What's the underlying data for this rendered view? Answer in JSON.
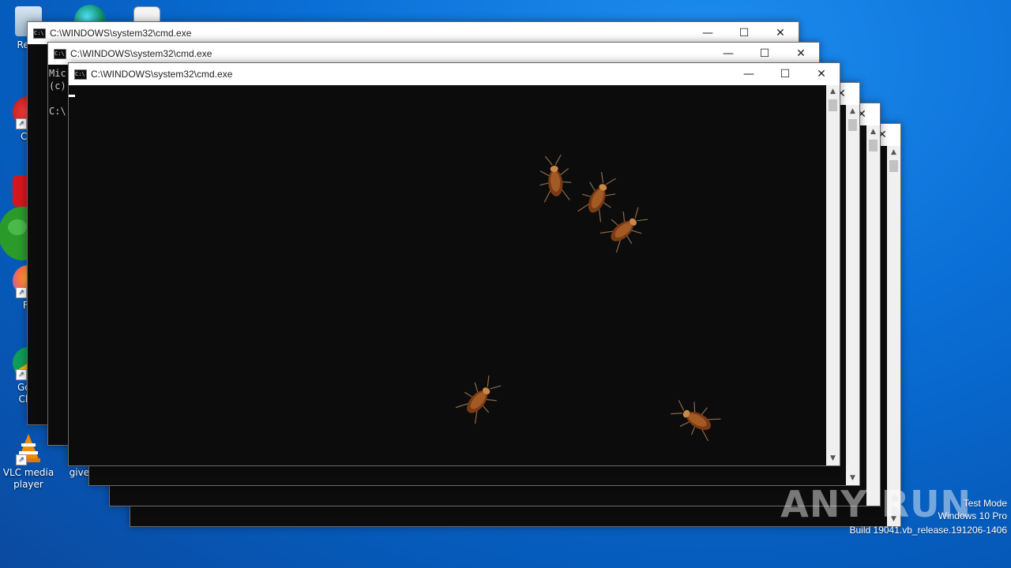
{
  "desktop": {
    "icons": [
      {
        "name": "recycle-bin",
        "label": "Recy"
      },
      {
        "name": "ccleaner",
        "label": "CCl"
      },
      {
        "name": "acrobat",
        "label": ""
      },
      {
        "name": "firefox",
        "label": "Fir"
      },
      {
        "name": "chrome",
        "label": "Goo Chr"
      },
      {
        "name": "vlc",
        "label": "VLC media player"
      },
      {
        "name": "givenh",
        "label": "givenh"
      }
    ]
  },
  "windows": [
    {
      "title": "C:\\WINDOWS\\system32\\cmd.exe"
    },
    {
      "title": "C:\\WINDOWS\\system32\\cmd.exe",
      "console_lines": [
        "Mic",
        "(c)",
        "",
        "C:\\"
      ]
    },
    {
      "title": "C:\\WINDOWS\\system32\\cmd.exe"
    }
  ],
  "titlebar_buttons": {
    "minimize": "—",
    "maximize": "☐",
    "close": "✕"
  },
  "scrollbar": {
    "up": "▲",
    "down": "▼"
  },
  "watermark": "ANY RUN",
  "os_info": {
    "mode": "Test Mode",
    "edition": "Windows 10 Pro",
    "build": "Build 19041.vb_release.191206-1406"
  }
}
